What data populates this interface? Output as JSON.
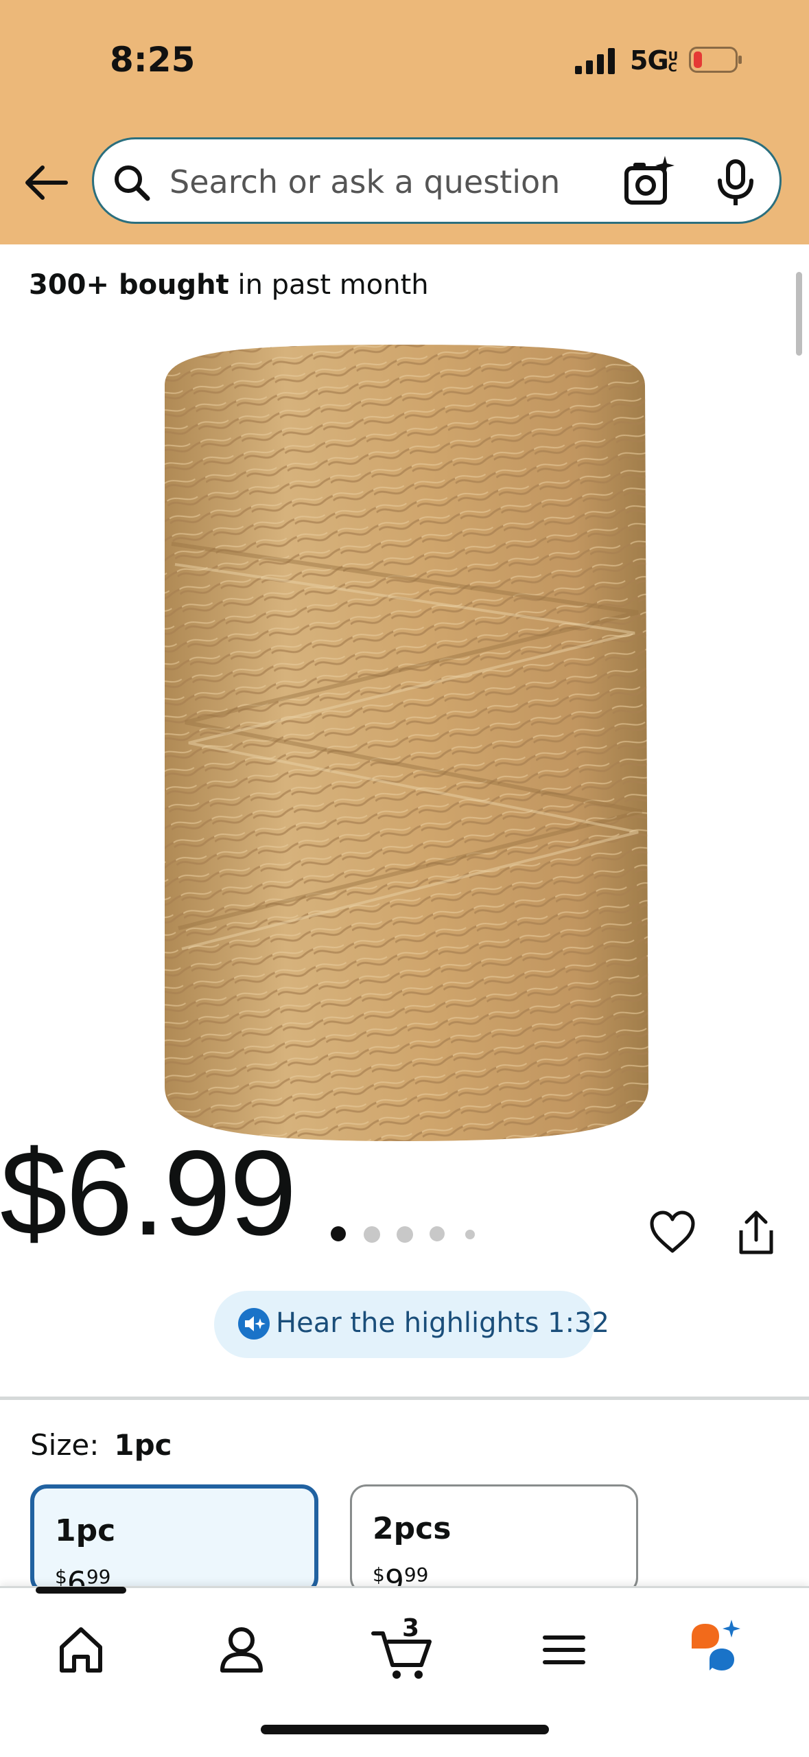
{
  "status_bar": {
    "time": "8:25",
    "network": "5G",
    "network_suffix": "UC"
  },
  "search": {
    "placeholder": "Search or ask a question"
  },
  "product": {
    "bought_bold": "300+ bought",
    "bought_rest": " in past month",
    "image_alt": "Jute twine spool",
    "price": "$6.99",
    "image_dots": {
      "total": 5,
      "active_index": 0
    },
    "hear_highlights": "Hear the highlights 1:32"
  },
  "size": {
    "label": "Size:",
    "selected": "1pc",
    "options": [
      {
        "name": "1pc",
        "currency": "$",
        "whole": "6",
        "fraction": "99"
      },
      {
        "name": "2pcs",
        "currency": "$",
        "whole": "9",
        "fraction": "99"
      }
    ]
  },
  "bottom_nav": {
    "cart_count": "3",
    "items": [
      "home-icon",
      "account-icon",
      "cart-icon",
      "menu-icon",
      "rufus-icon"
    ]
  },
  "colors": {
    "header_bg": "#ecb879",
    "selected_border": "#2162a1",
    "hear_bg": "#e3f2fb"
  }
}
